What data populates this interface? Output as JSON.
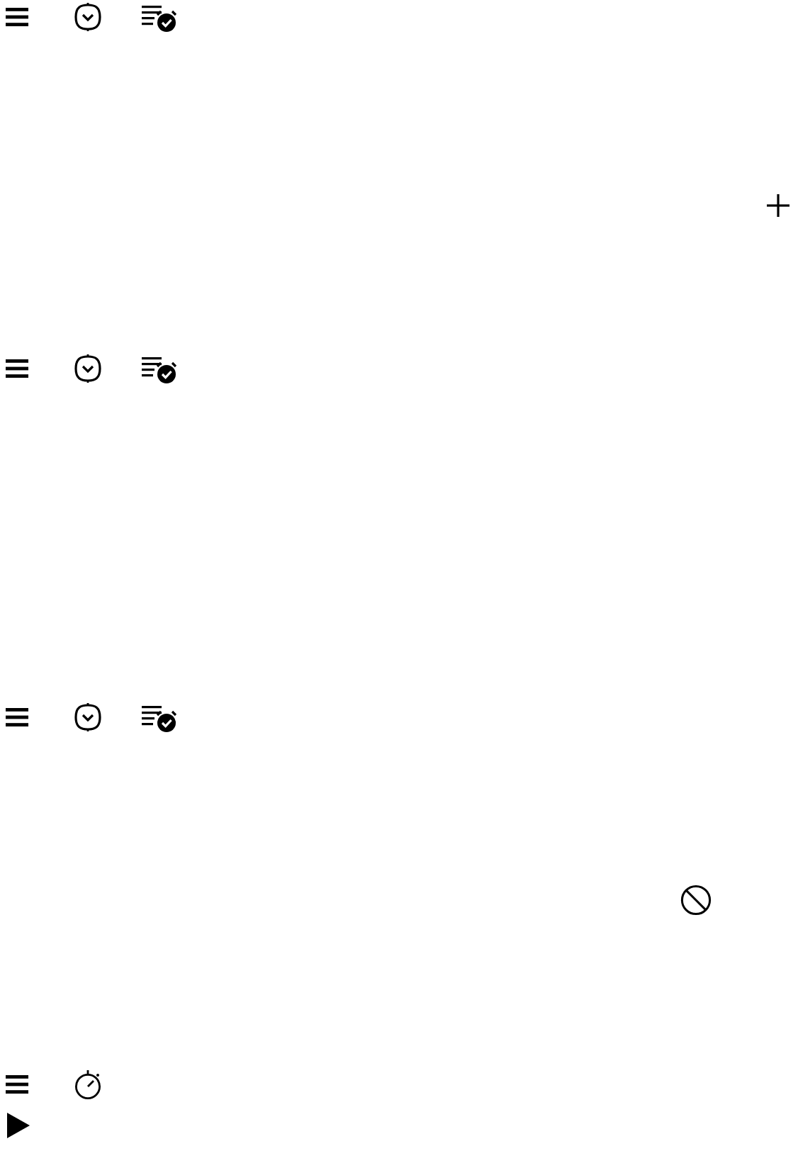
{
  "panels": [
    {
      "toolbar": [
        {
          "kind": "menu"
        },
        {
          "kind": "watch"
        },
        {
          "kind": "alarms"
        }
      ],
      "action": {
        "kind": "add"
      }
    },
    {
      "toolbar": [
        {
          "kind": "menu"
        },
        {
          "kind": "watch"
        },
        {
          "kind": "alarms"
        }
      ]
    },
    {
      "toolbar": [
        {
          "kind": "menu"
        },
        {
          "kind": "watch"
        },
        {
          "kind": "alarms"
        }
      ],
      "action": {
        "kind": "block"
      }
    },
    {
      "toolbar": [
        {
          "kind": "menu"
        },
        {
          "kind": "stopwatch"
        }
      ],
      "action": {
        "kind": "play"
      }
    }
  ]
}
